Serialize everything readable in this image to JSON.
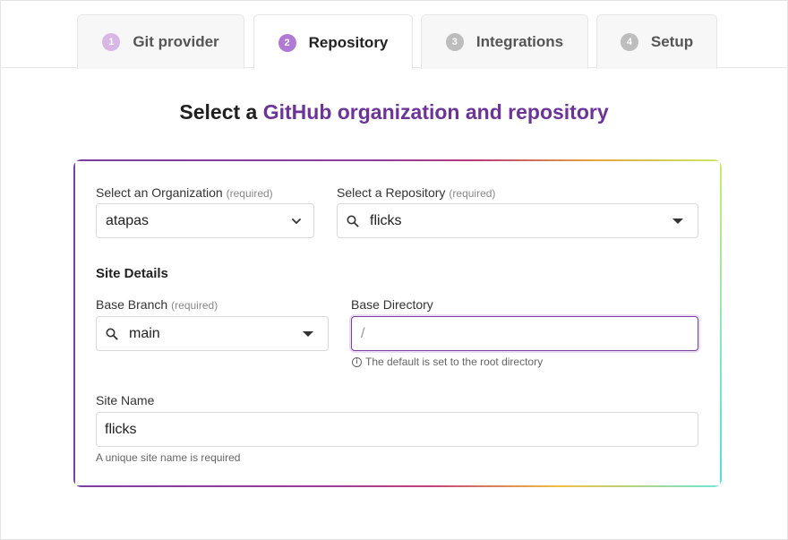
{
  "tabs": [
    {
      "num": "1",
      "label": "Git provider"
    },
    {
      "num": "2",
      "label": "Repository"
    },
    {
      "num": "3",
      "label": "Integrations"
    },
    {
      "num": "4",
      "label": "Setup"
    }
  ],
  "heading": {
    "prefix": "Select a ",
    "accent": "GitHub organization and repository"
  },
  "organization": {
    "label": "Select an Organization",
    "required": "(required)",
    "value": "atapas"
  },
  "repository": {
    "label": "Select a Repository",
    "required": "(required)",
    "value": "flicks"
  },
  "site_details": {
    "title": "Site Details"
  },
  "base_branch": {
    "label": "Base Branch",
    "required": "(required)",
    "value": "main"
  },
  "base_directory": {
    "label": "Base Directory",
    "placeholder": "/",
    "value": "",
    "help": "The default is set to the root directory"
  },
  "site_name": {
    "label": "Site Name",
    "value": "flicks",
    "help": "A unique site name is required"
  },
  "colors": {
    "accent": "#6c3399",
    "active_step": "#b07ad4",
    "done_step": "#d8b7e6",
    "inactive_step": "#bdbdbd"
  }
}
